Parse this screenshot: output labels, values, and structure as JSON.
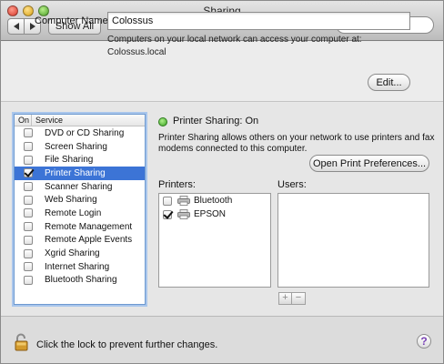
{
  "window": {
    "title": "Sharing"
  },
  "toolbar": {
    "show_all_label": "Show All",
    "search_placeholder": ""
  },
  "computer_name": {
    "label": "Computer Name:",
    "value": "Colossus",
    "description_line1": "Computers on your local network can access your computer at:",
    "description_line2": "Colossus.local",
    "edit_label": "Edit..."
  },
  "services": {
    "header_on": "On",
    "header_service": "Service",
    "items": [
      {
        "label": "DVD or CD Sharing",
        "checked": false,
        "selected": false
      },
      {
        "label": "Screen Sharing",
        "checked": false,
        "selected": false
      },
      {
        "label": "File Sharing",
        "checked": false,
        "selected": false
      },
      {
        "label": "Printer Sharing",
        "checked": true,
        "selected": true
      },
      {
        "label": "Scanner Sharing",
        "checked": false,
        "selected": false
      },
      {
        "label": "Web Sharing",
        "checked": false,
        "selected": false
      },
      {
        "label": "Remote Login",
        "checked": false,
        "selected": false
      },
      {
        "label": "Remote Management",
        "checked": false,
        "selected": false
      },
      {
        "label": "Remote Apple Events",
        "checked": false,
        "selected": false
      },
      {
        "label": "Xgrid Sharing",
        "checked": false,
        "selected": false
      },
      {
        "label": "Internet Sharing",
        "checked": false,
        "selected": false
      },
      {
        "label": "Bluetooth Sharing",
        "checked": false,
        "selected": false
      }
    ]
  },
  "detail": {
    "status": "Printer Sharing: On",
    "status_color": "#3aa224",
    "description_line1": "Printer Sharing allows others on your network to use printers and fax",
    "description_line2": "modems connected to this computer.",
    "open_prefs_label": "Open Print Preferences...",
    "printers_label": "Printers:",
    "users_label": "Users:",
    "printers": [
      {
        "label": "Bluetooth",
        "checked": false
      },
      {
        "label": "EPSON",
        "checked": true
      }
    ],
    "add_label": "+",
    "remove_label": "−"
  },
  "footer": {
    "lock_text": "Click the lock to prevent further changes.",
    "help_label": "?"
  }
}
